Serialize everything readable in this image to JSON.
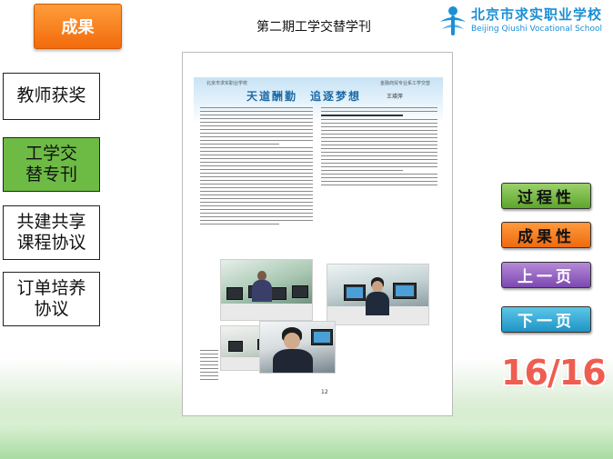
{
  "section": {
    "label": "成果"
  },
  "document": {
    "title": "第二期工学交替学刊"
  },
  "logo": {
    "name": "北京市求实职业学校",
    "english": "Beijing Qiushi Vocational School"
  },
  "sidebar": {
    "items": [
      {
        "label": "教师获奖",
        "active": false
      },
      {
        "label": "工学交替专刊",
        "active": true
      },
      {
        "label": "共建共享课程协议",
        "active": false
      },
      {
        "label": "订单培养协议",
        "active": false
      }
    ]
  },
  "page": {
    "header_left": "北京市求实职业学校",
    "header_right": "金融商贸专业系工学交替",
    "article_title": "天道酬勤　追逐梦想",
    "author": "王瑛萍",
    "page_number": "12"
  },
  "nav": {
    "process": "过程性",
    "result": "成果性",
    "prev": "上一页",
    "next": "下一页"
  },
  "pager": {
    "text": "16/16",
    "current": 16,
    "total": 16
  },
  "colors": {
    "section_tab": "#f26a0c",
    "sidebar_active": "#6dbb45",
    "logo_blue": "#1b8fd4",
    "btn_process": "#5da52c",
    "btn_result": "#ee6a10",
    "btn_prev": "#7b48b0",
    "btn_next": "#1f94c6",
    "pager_red": "#ef5d50"
  },
  "icons": {
    "logo": "qiushi-logo-icon"
  }
}
